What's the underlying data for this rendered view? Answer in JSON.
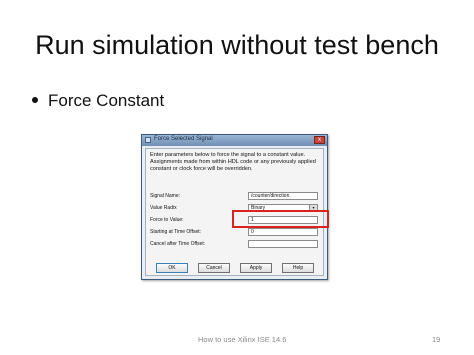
{
  "slide": {
    "title": "Run simulation without test bench",
    "bullet": "Force Constant",
    "footer_text": "How to use Xilinx ISE 14.6",
    "page_number": "19"
  },
  "dialog": {
    "title": "Force Selected Signal",
    "close_glyph": "x",
    "instructions": "Enter parameters below to force the signal to a constant value. Assignments made from within HDL code or any previously applied constant or clock force will be overridden.",
    "fields": [
      {
        "label": "Signal Name:",
        "value": "/counter/direction"
      },
      {
        "label": "Value Radix",
        "value": "Binary",
        "dropdown_glyph": "▾"
      },
      {
        "label": "Force to Value:",
        "value": "1"
      },
      {
        "label": "Starting at Time Offset:",
        "value": "0"
      },
      {
        "label": "Cancel after Time Offset:",
        "value": ""
      }
    ],
    "buttons": {
      "ok": "OK",
      "cancel": "Cancel",
      "apply": "Apply",
      "help": "Help"
    }
  },
  "colors": {
    "highlight": "#d82323",
    "titlebar": "#7f9ec3"
  }
}
